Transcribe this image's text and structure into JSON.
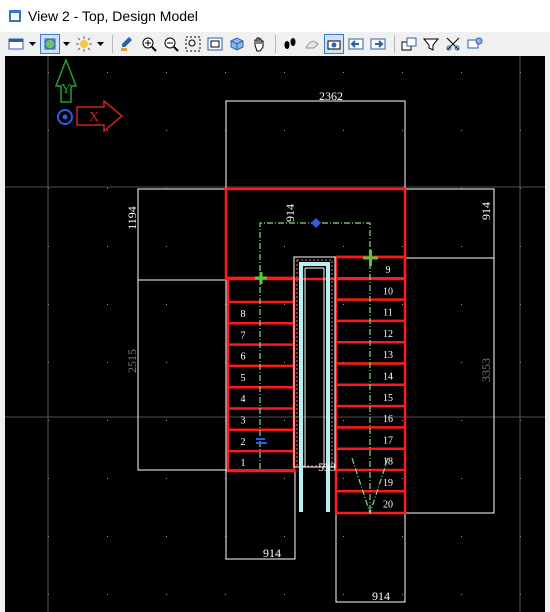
{
  "window": {
    "title": "View 2 - Top, Design Model"
  },
  "toolbar": {
    "icons": [
      "view-attributes-icon",
      "view-display-mode-icon",
      "render-icon",
      "clip-volume-icon",
      "update-view-icon",
      "zoom-in-icon",
      "zoom-out-icon",
      "window-area-icon",
      "fit-view-icon",
      "rotate-view-icon",
      "pan-icon",
      "walk-icon",
      "view-previous-icon",
      "view-next-icon",
      "active-view-icon",
      "view-list-back-icon",
      "view-list-forward-icon",
      "copy-view-icon",
      "clip-mask-icon",
      "camera-icon",
      "named-views-icon"
    ]
  },
  "colors": {
    "background": "#000000",
    "wall": "#ffffff",
    "stair": "#ff1a1a",
    "walkline": "#7fe07f",
    "x_axis": "#cc2222",
    "y_axis": "#1f9f2f",
    "cyan_rail": "#b7f0f0"
  },
  "axes": {
    "y_label": "Y",
    "x_label": "X"
  },
  "dimensions": {
    "top": "2362",
    "left_upper": "1194",
    "left_lower": "2515",
    "right_upper": "914",
    "right_lower": "3353",
    "flight_width": "914",
    "bottom_left": "914",
    "bottom_right": "914",
    "gap": "533"
  },
  "left_treads": [
    "8",
    "7",
    "6",
    "5",
    "4",
    "3",
    "2",
    "1"
  ],
  "right_treads": [
    "9",
    "10",
    "11",
    "12",
    "13",
    "14",
    "15",
    "16",
    "17",
    "18",
    "19",
    "20"
  ]
}
